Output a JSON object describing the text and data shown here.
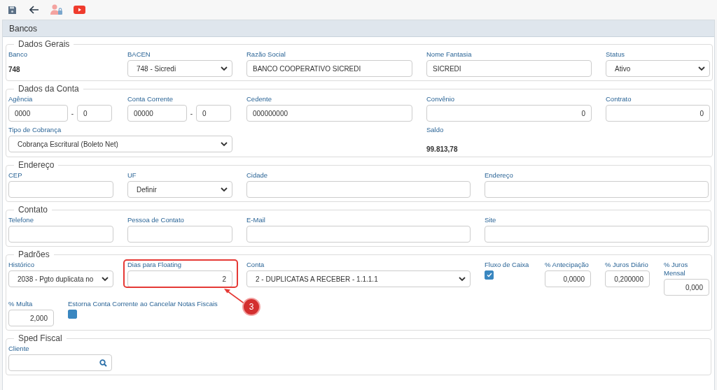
{
  "panel": {
    "title": "Bancos"
  },
  "sections": [
    {
      "legend": "Dados Gerais",
      "rows": [
        [
          {
            "label": "Banco",
            "kind": "static",
            "value": "748"
          },
          {
            "label": "BACEN",
            "kind": "select",
            "value": "748 - Sicredi"
          },
          {
            "label": "Razão Social",
            "kind": "text",
            "value": "BANCO COOPERATIVO SICREDI"
          },
          {
            "label": "Nome Fantasia",
            "kind": "text",
            "value": "SICREDI"
          },
          {
            "label": "Status",
            "kind": "select",
            "value": "Ativo"
          }
        ]
      ]
    },
    {
      "legend": "Dados da Conta",
      "rows": [
        [
          {
            "label": "Agência",
            "kind": "split",
            "value": "0000",
            "separator": "-",
            "digit": "0"
          },
          {
            "label": "Conta Corrente",
            "kind": "split",
            "value": "00000",
            "separator": "-",
            "digit": "0"
          },
          {
            "label": "Cedente",
            "kind": "text",
            "value": "000000000"
          },
          {
            "label": "Convênio",
            "kind": "number",
            "value": "0"
          },
          {
            "label": "Contrato",
            "kind": "number",
            "value": "0"
          }
        ],
        [
          {
            "label": "Tipo de Cobrança",
            "kind": "select",
            "value": "Cobrança Escritural (Boleto Net)"
          },
          "",
          "",
          {
            "label": "Saldo",
            "kind": "static",
            "value": "99.813,78"
          }
        ]
      ]
    },
    {
      "legend": "Endereço",
      "rows": [
        [
          {
            "label": "CEP",
            "kind": "text"
          },
          {
            "label": "UF",
            "kind": "select",
            "value": "Definir"
          },
          {
            "label": "Cidade",
            "kind": "text"
          },
          {
            "label": "Endereço",
            "kind": "text"
          }
        ]
      ]
    },
    {
      "legend": "Contato",
      "rows": [
        [
          {
            "label": "Telefone",
            "kind": "text"
          },
          {
            "label": "Pessoa de Contato",
            "kind": "text"
          },
          {
            "label": "E-Mail",
            "kind": "text"
          },
          {
            "label": "Site",
            "kind": "text"
          }
        ]
      ]
    },
    {
      "legend": "Padrões",
      "rows": [
        [
          {
            "label": "Histórico",
            "kind": "select",
            "value": "2038 - Pgto duplicata no"
          },
          {
            "label": "Dias para Floating",
            "kind": "number",
            "value": "2",
            "highlighted": true,
            "callout": "3"
          },
          {
            "label": "Conta",
            "kind": "select",
            "value": "2 - DUPLICATAS A RECEBER - 1.1.1.1"
          },
          {
            "label": "Fluxo de Caixa",
            "kind": "checkbox",
            "checked": true
          },
          {
            "label": "% Antecipação",
            "kind": "number",
            "value": "0,0000"
          },
          {
            "label": "% Juros Diário",
            "kind": "number",
            "value": "0,200000"
          },
          {
            "label": "% Juros Mensal",
            "kind": "number",
            "value": "0,000"
          }
        ],
        [
          {
            "label": "% Multa",
            "kind": "number",
            "value": "2,000"
          },
          {
            "label": "Estorna Conta Corrente ao Cancelar Notas Fiscais",
            "kind": "checkbox",
            "checked": false
          }
        ]
      ]
    },
    {
      "legend": "Sped Fiscal",
      "rows": [
        [
          {
            "label": "Cliente",
            "kind": "search"
          }
        ]
      ]
    }
  ]
}
